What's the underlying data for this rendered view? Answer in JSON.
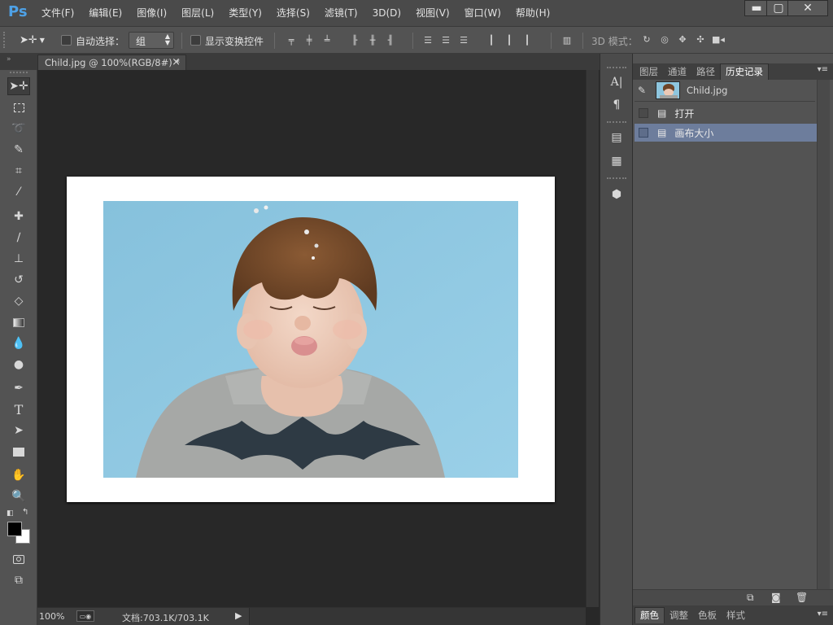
{
  "app": {
    "logo": "Ps"
  },
  "menus": [
    "文件(F)",
    "编辑(E)",
    "图像(I)",
    "图层(L)",
    "类型(Y)",
    "选择(S)",
    "滤镜(T)",
    "3D(D)",
    "视图(V)",
    "窗口(W)",
    "帮助(H)"
  ],
  "window_controls": {
    "minimize": "▬",
    "maximize": "▢",
    "close": "✕"
  },
  "options": {
    "auto_select_label": "自动选择：",
    "auto_select_value": "组",
    "show_transform_label": "显示变换控件",
    "mode3d_label": "3D 模式："
  },
  "document": {
    "tab_title": "Child.jpg @ 100%(RGB/8#) *",
    "tab_close": "×",
    "zoom": "100%",
    "doc_info": "文档:703.1K/703.1K",
    "print_badge": "▭◉"
  },
  "panel": {
    "tabs": [
      "图层",
      "通道",
      "路径",
      "历史记录"
    ],
    "active_tab_index": 3,
    "snapshot_name": "Child.jpg",
    "history": [
      {
        "label": "打开",
        "selected": false
      },
      {
        "label": "画布大小",
        "selected": true
      }
    ],
    "bottom_tabs": [
      "颜色",
      "调整",
      "色板",
      "样式"
    ],
    "bottom_active_index": 0
  },
  "colors": {
    "accent": "#4ea1e6",
    "selected_row": "#6d7d9c",
    "canvas_bg": "#282828",
    "panel_bg": "#535353",
    "photo_bg": "#8ec6df"
  }
}
